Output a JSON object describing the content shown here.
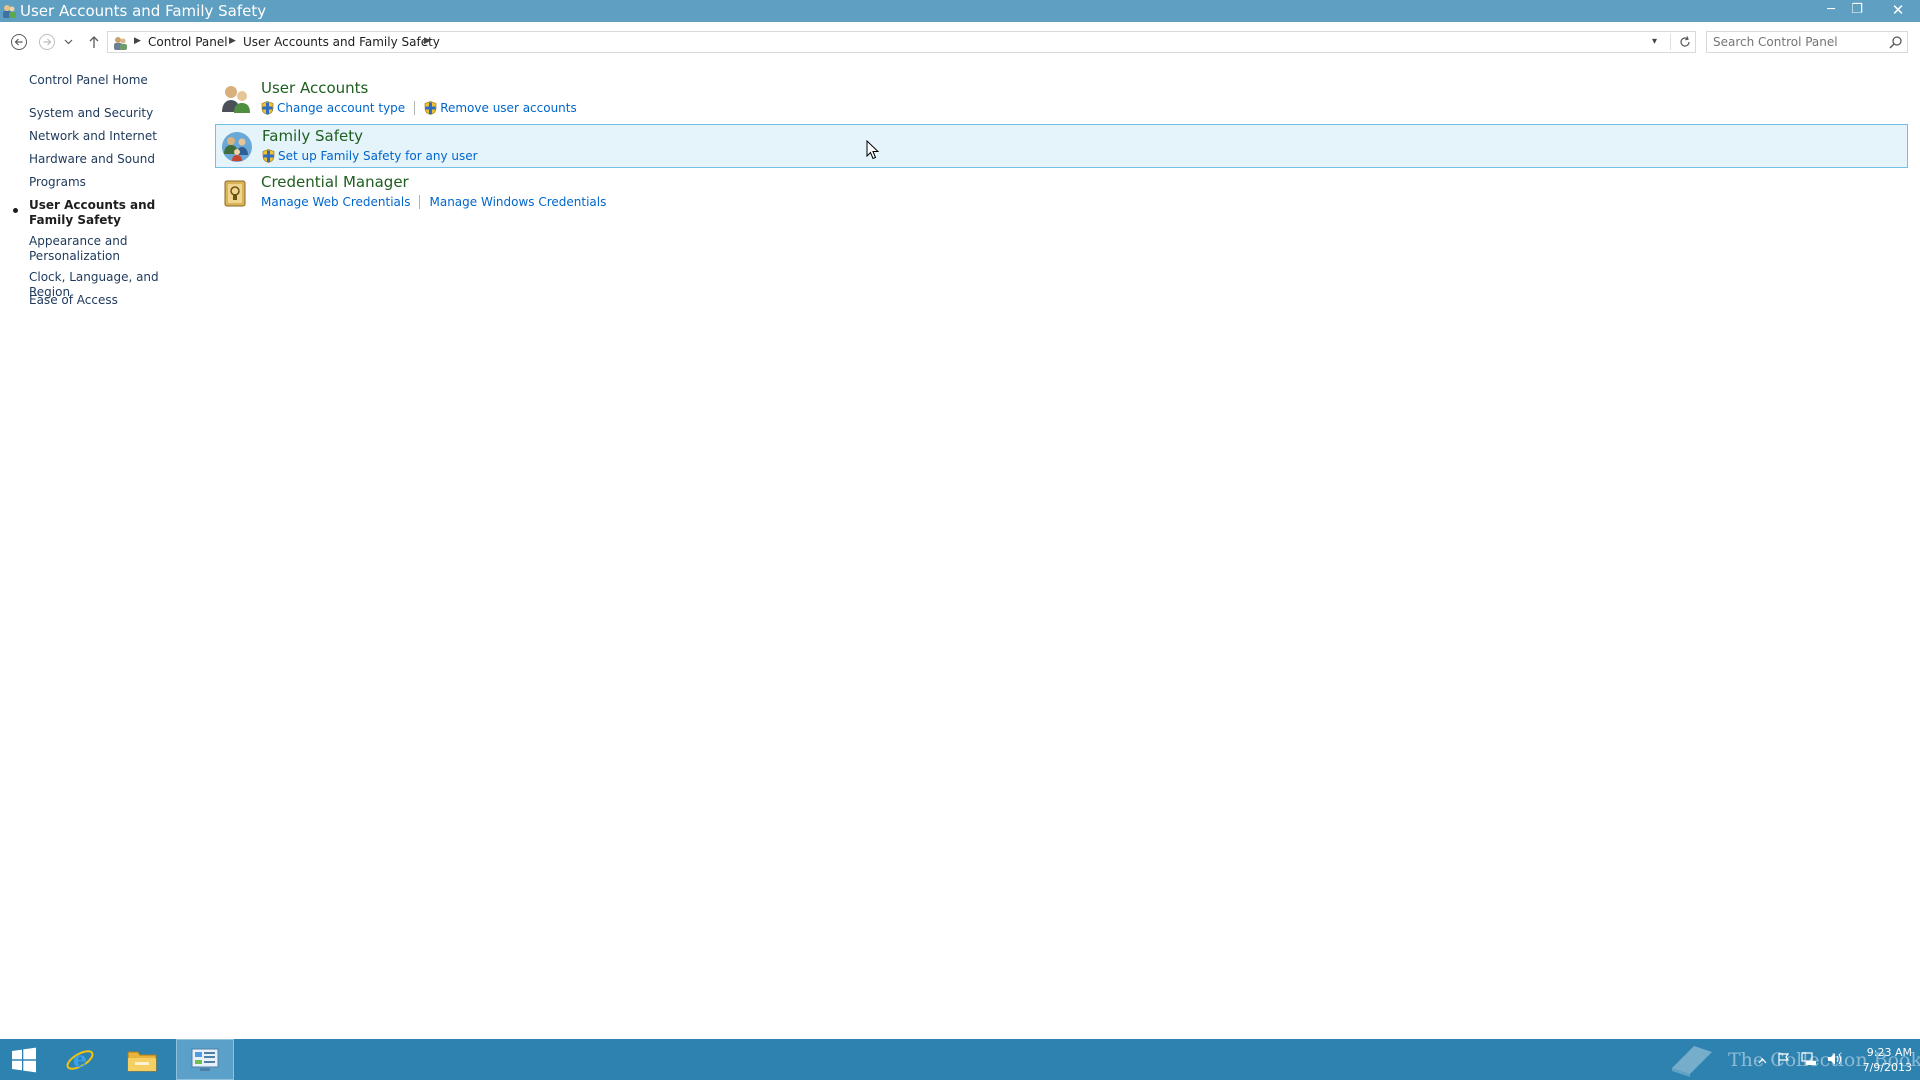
{
  "window": {
    "title": "User Accounts and Family Safety",
    "controls": {
      "minimize": "─",
      "maximize": "❐",
      "close": "✕"
    }
  },
  "address_bar": {
    "breadcrumbs": [
      "Control Panel",
      "User Accounts and Family Safety"
    ]
  },
  "search": {
    "placeholder": "Search Control Panel"
  },
  "left_nav": {
    "home": "Control Panel Home",
    "categories": [
      {
        "label": "System and Security"
      },
      {
        "label": "Network and Internet"
      },
      {
        "label": "Hardware and Sound"
      },
      {
        "label": "Programs"
      },
      {
        "label": "User Accounts and Family Safety",
        "active": true
      },
      {
        "label": "Appearance and Personalization"
      },
      {
        "label": "Clock, Language, and Region"
      },
      {
        "label": "Ease of Access"
      }
    ]
  },
  "sections": [
    {
      "icon": "user-accounts-icon",
      "title": "User Accounts",
      "links": [
        {
          "label": "Change account type",
          "shield": true
        },
        {
          "label": "Remove user accounts",
          "shield": true
        }
      ]
    },
    {
      "icon": "family-safety-icon",
      "title": "Family Safety",
      "highlighted": true,
      "links": [
        {
          "label": "Set up Family Safety for any user",
          "shield": true
        }
      ]
    },
    {
      "icon": "credential-manager-icon",
      "title": "Credential Manager",
      "links": [
        {
          "label": "Manage Web Credentials",
          "shield": false
        },
        {
          "label": "Manage Windows Credentials",
          "shield": false
        }
      ]
    }
  ],
  "taskbar": {
    "apps": [
      "start-icon",
      "internet-explorer-icon",
      "file-explorer-icon",
      "control-panel-icon"
    ],
    "watermark": "The Collection Book",
    "clock": {
      "time": "9:23 AM",
      "date": "7/9/2013"
    }
  },
  "colors": {
    "titlebar": "#5f9fc1",
    "taskbar": "#2d82b0",
    "link": "#0066cc",
    "heading": "#1e5e1e",
    "highlight_bg": "#e5f3fb",
    "highlight_border": "#70c0e7"
  }
}
